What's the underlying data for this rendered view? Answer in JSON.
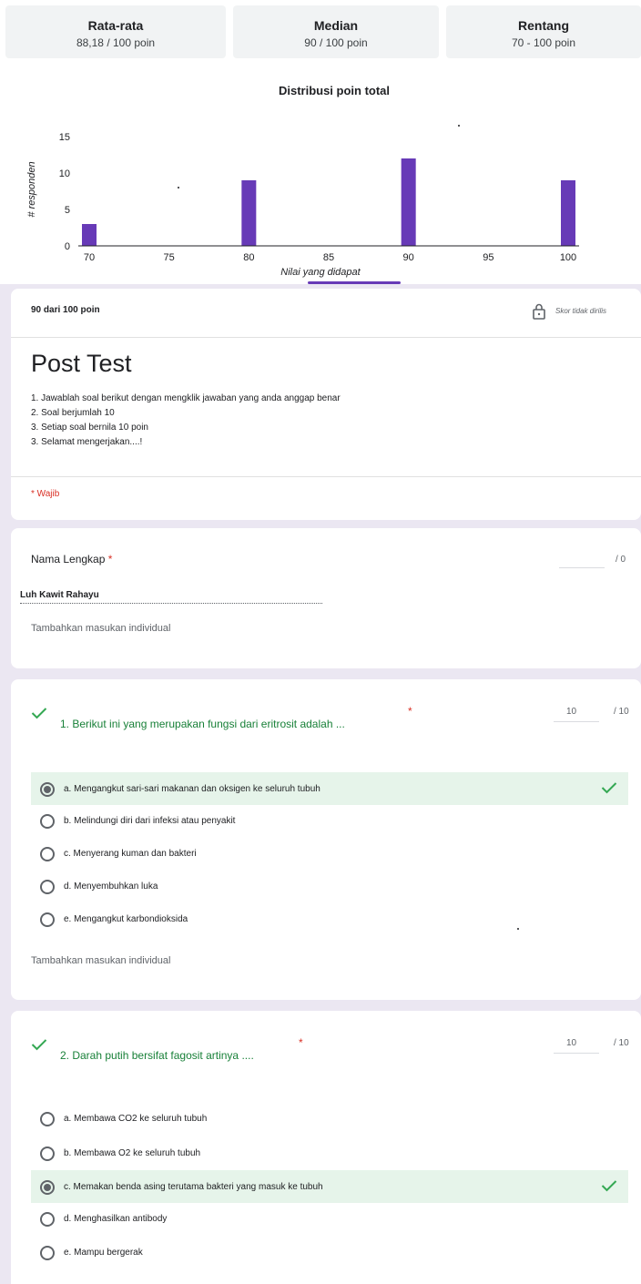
{
  "stats": [
    {
      "label": "Rata-rata",
      "value": "88,18 / 100 poin"
    },
    {
      "label": "Median",
      "value": "90 / 100 poin"
    },
    {
      "label": "Rentang",
      "value": "70 - 100 poin"
    }
  ],
  "chart_data": {
    "type": "bar",
    "title": "Distribusi poin total",
    "xlabel": "Nilai yang didapat",
    "ylabel": "# responden",
    "x": [
      70,
      80,
      90,
      100
    ],
    "values": [
      3,
      9,
      12,
      9
    ],
    "xticks": [
      "70",
      "75",
      "80",
      "85",
      "90",
      "95",
      "100"
    ],
    "yticks": [
      "0",
      "5",
      "10",
      "15"
    ],
    "xlim": [
      70,
      100
    ],
    "ylim": [
      0,
      15
    ],
    "color": "#673ab7",
    "grid": false
  },
  "score": {
    "points": "90 dari 100 poin",
    "lock_note": "Skor tidak dirilis",
    "form_title": "Post Test",
    "instructions": [
      "1. Jawablah soal berikut dengan mengklik jawaban yang anda anggap benar",
      "2. Soal berjumlah 10",
      "3. Setiap soal bernila 10 poin",
      "3. Selamat mengerjakan....!"
    ],
    "required_note": "* Wajib"
  },
  "name_question": {
    "title": "Nama Lengkap",
    "star": "*",
    "points_total": "/ 0",
    "answer": "Luh Kawit Rahayu",
    "feedback": "Tambahkan masukan individual"
  },
  "questions": [
    {
      "title": "1. Berikut ini yang merupakan fungsi dari eritrosit adalah ...",
      "star": "*",
      "points_value": "10",
      "points_total": "/ 10",
      "options": [
        "a. Mengangkut sari-sari makanan dan oksigen ke seluruh tubuh",
        "b. Melindungi diri dari infeksi atau penyakit",
        "c. Menyerang kuman dan bakteri",
        "d. Menyembuhkan luka",
        "e. Mengangkut karbondioksida"
      ],
      "selected_index": 0,
      "feedback": "Tambahkan masukan individual"
    },
    {
      "title": "2. Darah putih bersifat fagosit artinya ....",
      "star": "*",
      "points_value": "10",
      "points_total": "/ 10",
      "options": [
        "a. Membawa CO2 ke seluruh tubuh",
        "b. Membawa O2 ke seluruh tubuh",
        "c. Memakan benda asing terutama bakteri yang masuk ke tubuh",
        "d. Menghasilkan antibody",
        "e. Mampu bergerak"
      ],
      "selected_index": 2
    }
  ],
  "colors": {
    "accent": "#673ab7",
    "correct_bg": "#e6f4ea",
    "correct_check": "#34a853",
    "required": "#d93025"
  },
  "icons": {
    "lock": "lock-icon",
    "check": "check-icon",
    "radio": "radio-icon"
  }
}
